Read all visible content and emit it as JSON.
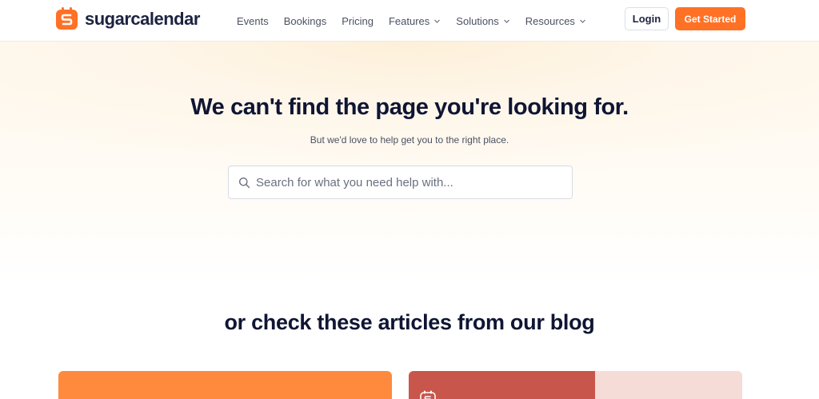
{
  "header": {
    "logo_text": "sugarcalendar",
    "nav": [
      {
        "label": "Events",
        "dropdown": false
      },
      {
        "label": "Bookings",
        "dropdown": false
      },
      {
        "label": "Pricing",
        "dropdown": false
      },
      {
        "label": "Features",
        "dropdown": true
      },
      {
        "label": "Solutions",
        "dropdown": true
      },
      {
        "label": "Resources",
        "dropdown": true
      }
    ],
    "login_label": "Login",
    "cta_label": "Get Started"
  },
  "hero": {
    "title": "We can't find the page you're looking for.",
    "subtitle": "But we'd love to help get you to the right place.",
    "search": {
      "placeholder": "Search for what you need help with...",
      "value": ""
    }
  },
  "blog": {
    "heading": "or check these articles from our blog"
  },
  "icons": {
    "logo": "sugarcalendar-logo-icon",
    "search": "search-icon",
    "dropdown": "chevron-down-icon"
  },
  "colors": {
    "brand_orange": "#ff7125",
    "text_dark": "#0f1533",
    "card1": "#ff8a3d",
    "card2_accent": "#c9564a",
    "card2_bg": "#f5dcd6"
  }
}
